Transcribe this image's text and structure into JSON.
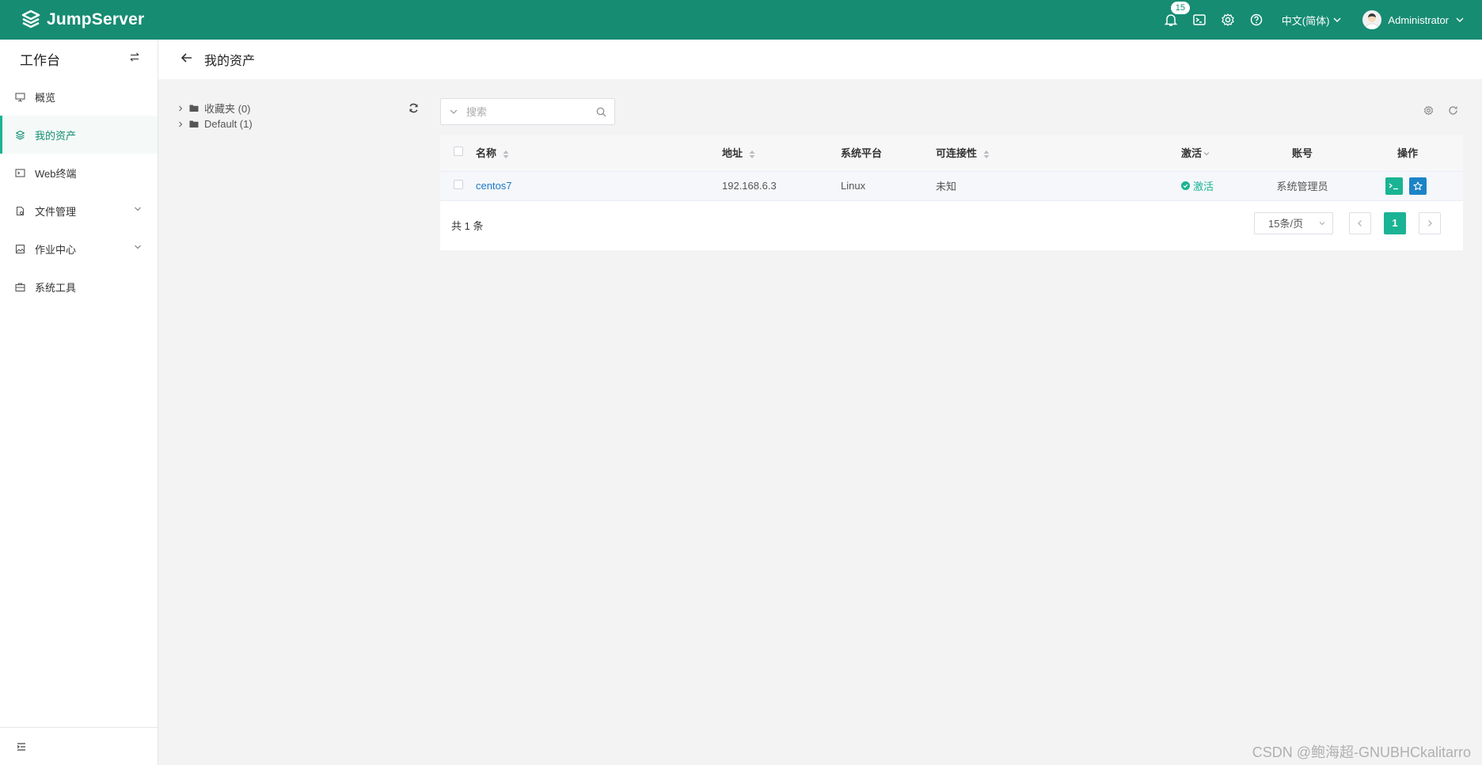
{
  "header": {
    "brand": "JumpServer",
    "notification_count": "15",
    "language": "中文(简体)",
    "user_name": "Administrator"
  },
  "sidebar": {
    "workspace_title": "工作台",
    "items": [
      {
        "label": "概览"
      },
      {
        "label": "我的资产"
      },
      {
        "label": "Web终端"
      },
      {
        "label": "文件管理"
      },
      {
        "label": "作业中心"
      },
      {
        "label": "系统工具"
      }
    ]
  },
  "page": {
    "title": "我的资产"
  },
  "tree": {
    "nodes": [
      {
        "label": "收藏夹 (0)"
      },
      {
        "label": "Default (1)"
      }
    ]
  },
  "search": {
    "placeholder": "搜索"
  },
  "table": {
    "columns": {
      "name": "名称",
      "address": "地址",
      "platform": "系统平台",
      "connectivity": "可连接性",
      "active": "激活",
      "account": "账号",
      "actions": "操作"
    },
    "rows": [
      {
        "name": "centos7",
        "address": "192.168.6.3",
        "platform": "Linux",
        "connectivity": "未知",
        "active": "激活",
        "account": "系统管理员"
      }
    ]
  },
  "pagination": {
    "total": "共 1 条",
    "page_size": "15条/页",
    "current_page": "1"
  },
  "watermark": "CSDN @鲍海超-GNUBHCkalitarro",
  "colors": {
    "brand": "#168c73",
    "accent": "#1ab394",
    "link": "#1d7ac7"
  }
}
